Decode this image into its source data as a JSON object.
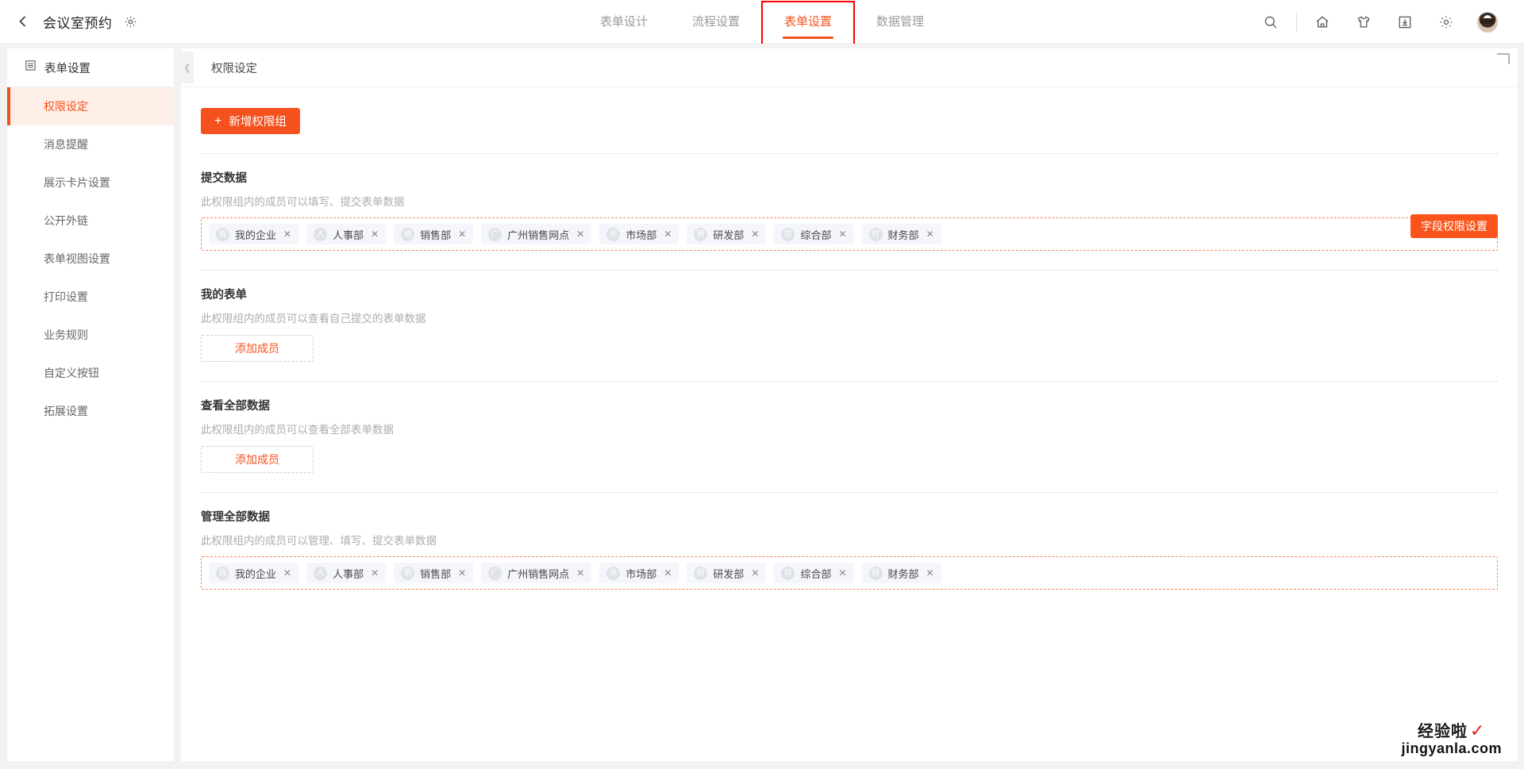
{
  "topbar": {
    "back_icon": "chevron-left-icon",
    "app_title": "会议室预约",
    "gear_icon": "gear-icon",
    "tabs": [
      {
        "label": "表单设计",
        "active": false
      },
      {
        "label": "流程设置",
        "active": false
      },
      {
        "label": "表单设置",
        "active": true
      },
      {
        "label": "数据管理",
        "active": false
      }
    ],
    "icons": [
      {
        "name": "search-icon"
      },
      {
        "name": "home-icon"
      },
      {
        "name": "skin-icon"
      },
      {
        "name": "download-icon"
      },
      {
        "name": "settings-gear-icon"
      },
      {
        "name": "user-avatar"
      }
    ]
  },
  "sidebar": {
    "header": "表单设置",
    "header_icon": "list-icon",
    "items": [
      {
        "label": "权限设定",
        "active": true
      },
      {
        "label": "消息提醒",
        "active": false
      },
      {
        "label": "展示卡片设置",
        "active": false
      },
      {
        "label": "公开外链",
        "active": false
      },
      {
        "label": "表单视图设置",
        "active": false
      },
      {
        "label": "打印设置",
        "active": false
      },
      {
        "label": "业务规则",
        "active": false
      },
      {
        "label": "自定义按钮",
        "active": false
      },
      {
        "label": "拓展设置",
        "active": false
      }
    ]
  },
  "content": {
    "breadcrumb": "权限设定",
    "collapse_icon": "chevron-left-icon",
    "add_group_button": "新增权限组",
    "add_group_plus": "+",
    "field_permission_button": "字段权限设置",
    "sections": [
      {
        "title": "提交数据",
        "desc": "此权限组内的成员可以填写、提交表单数据",
        "type": "tags",
        "tags": [
          {
            "initial": "我",
            "label": "我的企业"
          },
          {
            "initial": "人",
            "label": "人事部"
          },
          {
            "initial": "销",
            "label": "销售部"
          },
          {
            "initial": "广",
            "label": "广州销售网点"
          },
          {
            "initial": "市",
            "label": "市场部"
          },
          {
            "initial": "研",
            "label": "研发部"
          },
          {
            "initial": "综",
            "label": "综合部"
          },
          {
            "initial": "财",
            "label": "财务部"
          }
        ]
      },
      {
        "title": "我的表单",
        "desc": "此权限组内的成员可以查看自己提交的表单数据",
        "type": "button",
        "button": "添加成员"
      },
      {
        "title": "查看全部数据",
        "desc": "此权限组内的成员可以查看全部表单数据",
        "type": "button",
        "button": "添加成员"
      },
      {
        "title": "管理全部数据",
        "desc": "此权限组内的成员可以管理、填写、提交表单数据",
        "type": "tags",
        "tags": [
          {
            "initial": "我",
            "label": "我的企业"
          },
          {
            "initial": "人",
            "label": "人事部"
          },
          {
            "initial": "销",
            "label": "销售部"
          },
          {
            "initial": "广",
            "label": "广州销售网点"
          },
          {
            "initial": "市",
            "label": "市场部"
          },
          {
            "initial": "研",
            "label": "研发部"
          },
          {
            "initial": "综",
            "label": "综合部"
          },
          {
            "initial": "财",
            "label": "财务部"
          }
        ]
      }
    ],
    "tag_close_glyph": "✕"
  },
  "watermark": {
    "title": "经验啦",
    "check": "✓",
    "domain": "jingyanla.com"
  },
  "colors": {
    "accent": "#f4511e",
    "accent_button": "#fa541c",
    "annotation": "#ff0000",
    "active_bg": "#fdeee8"
  }
}
